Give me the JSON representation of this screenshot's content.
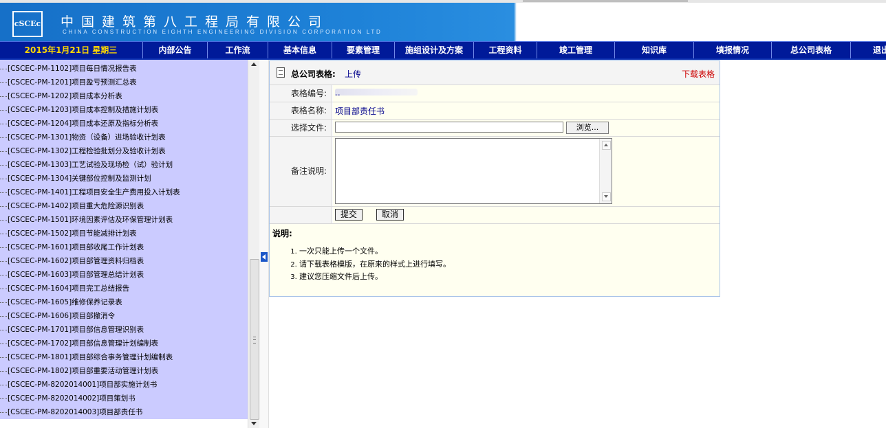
{
  "header": {
    "logo_text": "cSCEc",
    "company_cn": "中国建筑第八工程局有限公司",
    "company_en": "CHINA CONSTRUCTION EIGHTH ENGINEERING DIVISION CORPORATION LTD"
  },
  "nav": {
    "date": "2015年1月21日 星期三",
    "items": [
      "内部公告",
      "工作流",
      "基本信息",
      "要素管理",
      "施组设计及方案",
      "工程资料",
      "竣工管理",
      "知识库",
      "填报情况",
      "总公司表格",
      "退出"
    ]
  },
  "tree": {
    "items": [
      "[CSCEC-PM-1102]项目每日情况报告表",
      "[CSCEC-PM-1201]项目盈亏预测汇总表",
      "[CSCEC-PM-1202]项目成本分析表",
      "[CSCEC-PM-1203]项目成本控制及措施计划表",
      "[CSCEC-PM-1204]项目成本还原及指标分析表",
      "[CSCEC-PM-1301]物资（设备）进场验收计划表",
      "[CSCEC-PM-1302]工程检验批划分及验收计划表",
      "[CSCEC-PM-1303]工艺试验及现场检（试）验计划",
      "[CSCEC-PM-1304]关键部位控制及监测计划",
      "[CSCEC-PM-1401]工程项目安全生产费用投入计划表",
      "[CSCEC-PM-1402]项目重大危险源识别表",
      "[CSCEC-PM-1501]环境因素评估及环保管理计划表",
      "[CSCEC-PM-1502]项目节能减排计划表",
      "[CSCEC-PM-1601]项目部收尾工作计划表",
      "[CSCEC-PM-1602]项目部管理资料归档表",
      "[CSCEC-PM-1603]项目部管理总结计划表",
      "[CSCEC-PM-1604]项目完工总结报告",
      "[CSCEC-PM-1605]维修保养记录表",
      "[CSCEC-PM-1606]项目部撤消令",
      "[CSCEC-PM-1701]项目部信息管理识别表",
      "[CSCEC-PM-1702]项目部信息管理计划编制表",
      "[CSCEC-PM-1801]项目部综合事务管理计划编制表",
      "[CSCEC-PM-1802]项目部重要活动管理计划表",
      "[CSCEC-PM-8202014001]项目部实施计划书",
      "[CSCEC-PM-8202014002]项目策划书",
      "[CSCEC-PM-8202014003]项目部责任书"
    ]
  },
  "form": {
    "title": "总公司表格:",
    "upload_link": "上传",
    "download_link": "下载表格",
    "code_label": "表格编号:",
    "code_value": "--",
    "name_label": "表格名称:",
    "name_value": "项目部责任书",
    "file_label": "选择文件:",
    "browse_label": "浏览...",
    "note_label": "备注说明:",
    "submit_label": "提交",
    "cancel_label": "取消"
  },
  "notes": {
    "heading": "说明:",
    "items": [
      "一次只能上传一个文件。",
      "请下载表格模版，在原来的样式上进行填写。",
      "建议您压缩文件后上传。"
    ]
  },
  "colors": {
    "nav_bg": "#001a99",
    "date_text": "#ffd800",
    "tree_bg": "#cbcbff",
    "link": "#00008b",
    "download": "#cc0000"
  }
}
